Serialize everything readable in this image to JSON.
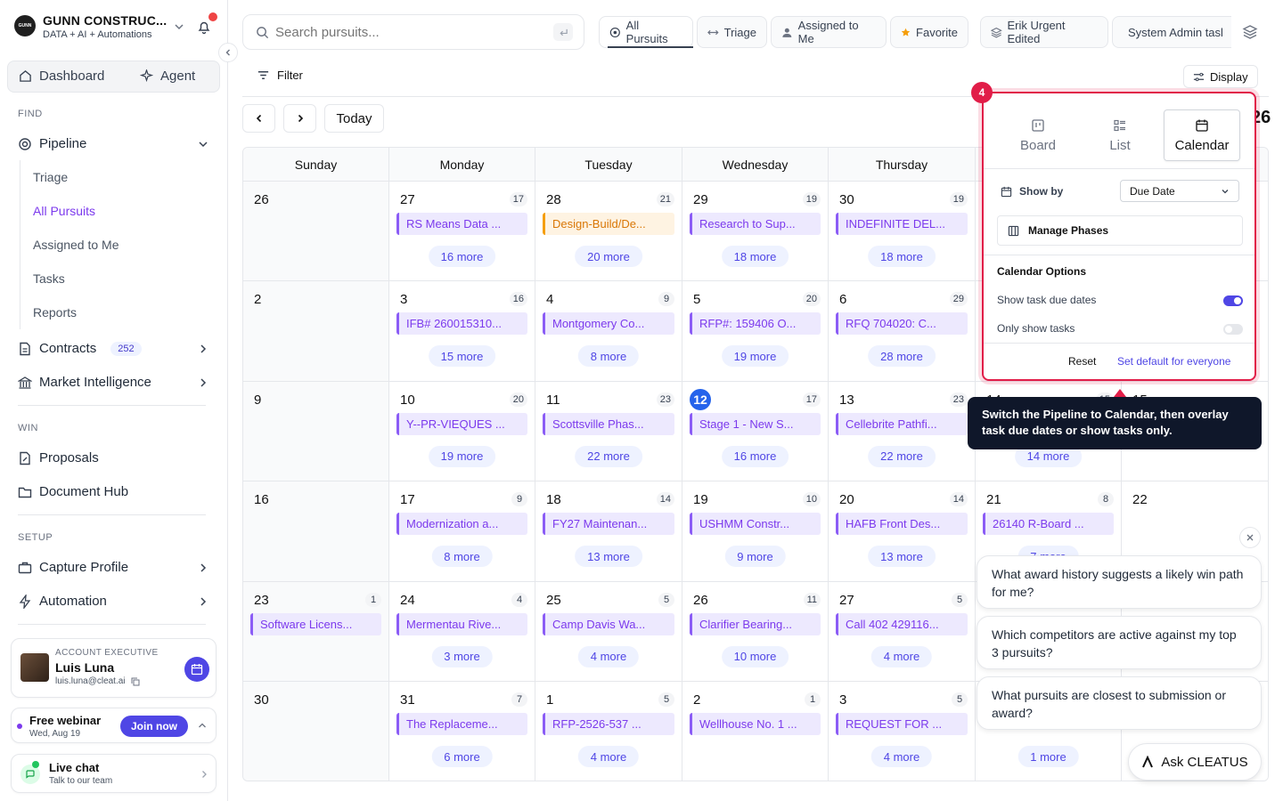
{
  "org": {
    "name": "GUNN CONSTRUC...",
    "subtitle": "DATA + AI + Automations",
    "logo_text": "GUNN"
  },
  "sidebar": {
    "dashboard": "Dashboard",
    "agent": "Agent",
    "find_label": "FIND",
    "pipeline": "Pipeline",
    "pipeline_items": [
      "Triage",
      "All Pursuits",
      "Assigned to Me",
      "Tasks",
      "Reports"
    ],
    "contracts": "Contracts",
    "contracts_count": "252",
    "market": "Market Intelligence",
    "win_label": "WIN",
    "proposals": "Proposals",
    "doc_hub": "Document Hub",
    "setup_label": "SETUP",
    "capture": "Capture Profile",
    "automation": "Automation"
  },
  "account": {
    "role": "ACCOUNT EXECUTIVE",
    "name": "Luis Luna",
    "email": "luis.luna@cleat.ai"
  },
  "webinar": {
    "title": "Free webinar",
    "date": "Wed, Aug 19",
    "cta": "Join now"
  },
  "chat": {
    "title": "Live chat",
    "sub": "Talk to our team"
  },
  "search": {
    "placeholder": "Search pursuits..."
  },
  "top_tabs": [
    "All Pursuits",
    "Triage",
    "Assigned to Me",
    "Favorite",
    "Erik Urgent Edited",
    "System Admin tasl"
  ],
  "toolbar": {
    "filter": "Filter",
    "display": "Display",
    "today": "Today",
    "month_partial": "26"
  },
  "weekdays": [
    "Sunday",
    "Monday",
    "Tuesday",
    "Wednesday",
    "Thursday",
    "Friday",
    "Saturday"
  ],
  "weeks": [
    [
      {
        "d": "26",
        "shade": true
      },
      {
        "d": "27",
        "c": "17",
        "ev": "RS Means Data ...",
        "more": "16 more"
      },
      {
        "d": "28",
        "c": "21",
        "ev": "Design-Build/De...",
        "orange": true,
        "more": "20 more"
      },
      {
        "d": "29",
        "c": "19",
        "ev": "Research to Sup...",
        "more": "18 more"
      },
      {
        "d": "30",
        "c": "19",
        "ev": "INDEFINITE DEL...",
        "more": "18 more"
      },
      {
        "d": ""
      },
      {
        "d": ""
      }
    ],
    [
      {
        "d": "2",
        "shade": true
      },
      {
        "d": "3",
        "c": "16",
        "ev": "IFB# 260015310...",
        "more": "15 more"
      },
      {
        "d": "4",
        "c": "9",
        "ev": "Montgomery Co...",
        "more": "8 more"
      },
      {
        "d": "5",
        "c": "20",
        "ev": "RFP#: 159406 O...",
        "more": "19 more"
      },
      {
        "d": "6",
        "c": "29",
        "ev": "RFQ 704020: C...",
        "more": "28 more"
      },
      {
        "d": ""
      },
      {
        "d": ""
      }
    ],
    [
      {
        "d": "9",
        "shade": true
      },
      {
        "d": "10",
        "c": "20",
        "ev": "Y--PR-VIEQUES ...",
        "more": "19 more"
      },
      {
        "d": "11",
        "c": "23",
        "ev": "Scottsville Phas...",
        "more": "22 more"
      },
      {
        "d": "12",
        "c": "17",
        "ev": "Stage 1 - New S...",
        "more": "16 more",
        "today": true
      },
      {
        "d": "13",
        "c": "23",
        "ev": "Cellebrite Pathfi...",
        "more": "22 more"
      },
      {
        "d": "14",
        "c": "15",
        "more": "14 more"
      },
      {
        "d": "15"
      }
    ],
    [
      {
        "d": "16",
        "shade": true
      },
      {
        "d": "17",
        "c": "9",
        "ev": "Modernization a...",
        "more": "8 more"
      },
      {
        "d": "18",
        "c": "14",
        "ev": "FY27 Maintenan...",
        "more": "13 more"
      },
      {
        "d": "19",
        "c": "10",
        "ev": "USHMM Constr...",
        "more": "9 more"
      },
      {
        "d": "20",
        "c": "14",
        "ev": "HAFB Front Des...",
        "more": "13 more"
      },
      {
        "d": "21",
        "c": "8",
        "ev": "26140 R-Board ...",
        "more": "7 more"
      },
      {
        "d": "22"
      }
    ],
    [
      {
        "d": "23",
        "c": "1",
        "ev": "Software Licens...",
        "shade": true
      },
      {
        "d": "24",
        "c": "4",
        "ev": "Mermentau Rive...",
        "more": "3 more"
      },
      {
        "d": "25",
        "c": "5",
        "ev": "Camp Davis Wa...",
        "more": "4 more"
      },
      {
        "d": "26",
        "c": "11",
        "ev": "Clarifier Bearing...",
        "more": "10 more"
      },
      {
        "d": "27",
        "c": "5",
        "ev": "Call 402 429116...",
        "more": "4 more"
      },
      {
        "d": ""
      },
      {
        "d": ""
      }
    ],
    [
      {
        "d": "30",
        "shade": true
      },
      {
        "d": "31",
        "c": "7",
        "ev": "The Replaceme...",
        "more": "6 more"
      },
      {
        "d": "1",
        "c": "5",
        "ev": "RFP-2526-537 ...",
        "more": "4 more"
      },
      {
        "d": "2",
        "c": "1",
        "ev": "Wellhouse No. 1 ..."
      },
      {
        "d": "3",
        "c": "5",
        "ev": "REQUEST FOR ...",
        "more": "4 more"
      },
      {
        "d": "",
        "more": "1 more"
      },
      {
        "d": ""
      }
    ]
  ],
  "display_popover": {
    "step": "4",
    "views": [
      "Board",
      "List",
      "Calendar"
    ],
    "show_by_label": "Show by",
    "show_by_value": "Due Date",
    "manage_phases": "Manage Phases",
    "options_title": "Calendar Options",
    "opt1": "Show task due dates",
    "opt1_on": true,
    "opt2": "Only show tasks",
    "opt2_on": false,
    "reset": "Reset",
    "set_default": "Set default for everyone"
  },
  "tooltip": "Switch the Pipeline to Calendar, then overlay task due dates or show tasks only.",
  "suggestions": [
    "What award history suggests a likely win path for me?",
    "Which competitors are active against my top 3 pursuits?",
    "What pursuits are closest to submission or award?"
  ],
  "ask": "Ask CLEATUS",
  "colors": {
    "accent": "#7c3aed",
    "highlight": "#e11d48",
    "today": "#2563eb"
  }
}
